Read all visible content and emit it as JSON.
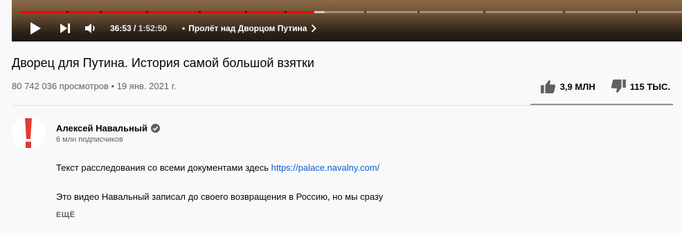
{
  "player": {
    "progress_fraction": 0.445,
    "current_time": "36:53",
    "separator": "/",
    "duration": "1:52:50",
    "chapter_bullet": "•",
    "chapter": "Пролёт над Дворцом Путина",
    "progress_color": "#ff0000"
  },
  "video": {
    "title": "Дворец для Путина. История самой большой взятки",
    "views": "80 742 036 просмотров",
    "meta_separator": "•",
    "date": "19 янв. 2021 г.",
    "likes": "3,9 МЛН",
    "dislikes": "115 ТЫС."
  },
  "channel": {
    "name": "Алексей Навальный",
    "subscribers": "6 млн подписчиков",
    "avatar_color": "#e53935"
  },
  "description": {
    "line1_text": "Текст расследования со всеми документами здесь ",
    "line1_link": "https://palace.navalny.com/",
    "line2": "Это видео Навальный записал до своего возвращения в Россию, но мы сразу",
    "more_label": "ЕЩЁ"
  },
  "icons": [
    "play-icon",
    "next-icon",
    "volume-icon",
    "chevron-right-icon",
    "thumb-up-icon",
    "thumb-down-icon",
    "verified-badge-icon"
  ]
}
